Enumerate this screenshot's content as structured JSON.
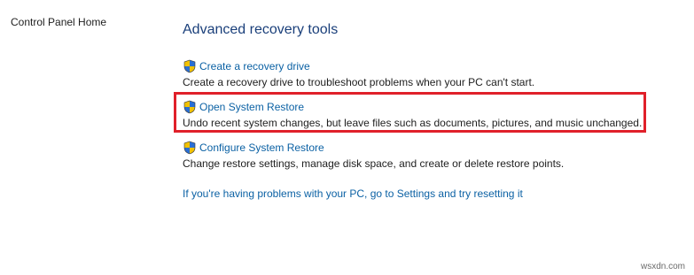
{
  "sidebar": {
    "home_link": "Control Panel Home"
  },
  "main": {
    "title": "Advanced recovery tools",
    "tools": [
      {
        "label": "Create a recovery drive",
        "description": "Create a recovery drive to troubleshoot problems when your PC can't start.",
        "icon": "uac-shield-icon"
      },
      {
        "label": "Open System Restore",
        "description": "Undo recent system changes, but leave files such as documents, pictures, and music unchanged.",
        "icon": "uac-shield-icon",
        "highlighted": true
      },
      {
        "label": "Configure System Restore",
        "description": "Change restore settings, manage disk space, and create or delete restore points.",
        "icon": "uac-shield-icon"
      }
    ],
    "reset_link": "If you're having problems with your PC, go to Settings and try resetting it"
  },
  "highlight_color": "#e0202a",
  "link_color": "#0b61a4",
  "watermark": "wsxdn.com"
}
